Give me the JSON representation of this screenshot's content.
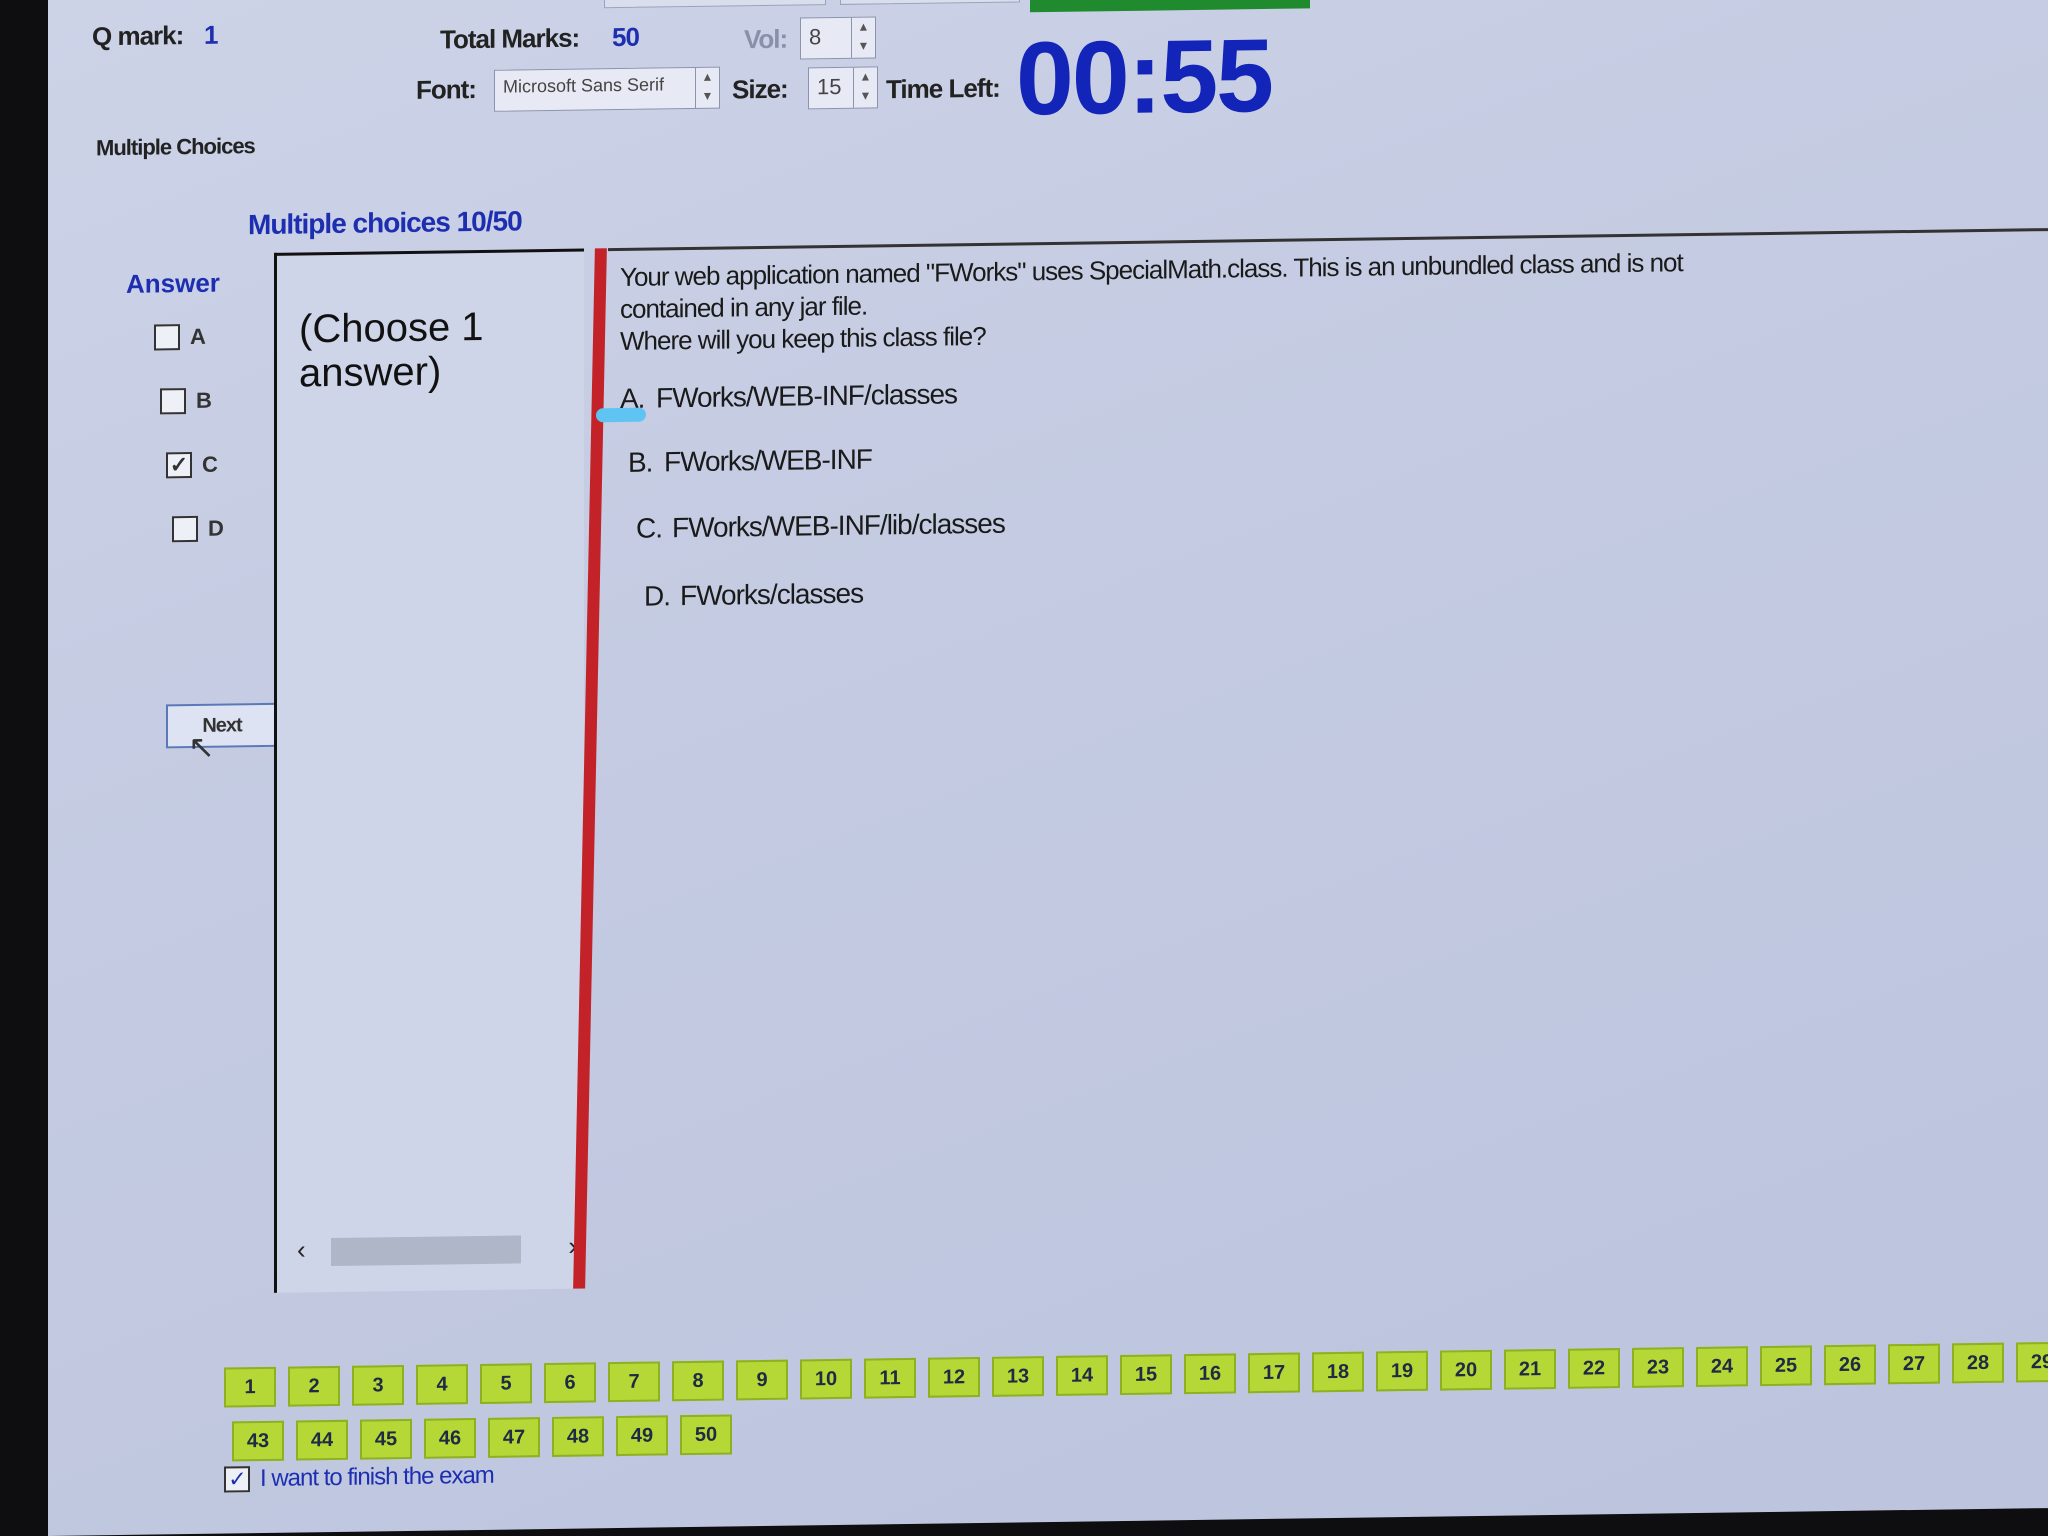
{
  "toolbar": {
    "q_mark_label": "Q mark:",
    "q_mark_value": "1",
    "total_marks_label": "Total Marks:",
    "total_marks_value": "50",
    "vol_label": "Vol:",
    "vol_value": "8",
    "font_label": "Font:",
    "font_value": "Microsoft Sans Serif",
    "size_label": "Size:",
    "size_value": "15",
    "time_left_label": "Time Left:",
    "timer": "00:55"
  },
  "section": {
    "type_label": "Multiple Choices",
    "heading": "Multiple choices 10/50"
  },
  "answer_panel": {
    "title": "Answer",
    "options": [
      {
        "letter": "A",
        "checked": false
      },
      {
        "letter": "B",
        "checked": false
      },
      {
        "letter": "C",
        "checked": true
      },
      {
        "letter": "D",
        "checked": false
      }
    ],
    "next_label": "Next"
  },
  "instruction": {
    "text": "(Choose 1 answer)"
  },
  "question": {
    "line1": "Your web application named \"FWorks\" uses SpecialMath.class. This is an unbundled class and is not",
    "line2": "contained in any jar file.",
    "line3": "Where will you keep this class file?",
    "options": [
      {
        "letter": "A.",
        "text": "FWorks/WEB-INF/classes"
      },
      {
        "letter": "B.",
        "text": "FWorks/WEB-INF"
      },
      {
        "letter": "C.",
        "text": "FWorks/WEB-INF/lib/classes"
      },
      {
        "letter": "D.",
        "text": "FWorks/classes"
      }
    ]
  },
  "navigator": {
    "row1": [
      "1",
      "2",
      "3",
      "4",
      "5",
      "6",
      "7",
      "8",
      "9",
      "10",
      "11",
      "12",
      "13",
      "14",
      "15",
      "16",
      "17",
      "18",
      "19",
      "20",
      "21",
      "22",
      "23",
      "24",
      "25",
      "26",
      "27",
      "28",
      "29"
    ],
    "row2": [
      "43",
      "44",
      "45",
      "46",
      "47",
      "48",
      "49",
      "50"
    ]
  },
  "finish": {
    "label": "I want to finish the exam",
    "checked": true
  },
  "colors": {
    "accent_blue": "#1d2fb0",
    "timer_blue": "#1225b8",
    "nav_green": "#b6d836",
    "red_divider": "#c32228"
  }
}
